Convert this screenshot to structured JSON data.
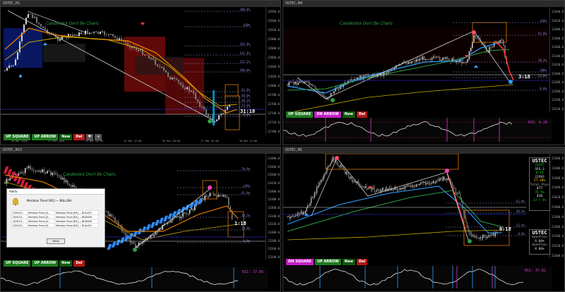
{
  "panes": [
    {
      "id": "h1",
      "title": "USTEC H1",
      "subtitle": "Candlestick Don't Be Charts",
      "title_color": "#2aa6f4",
      "countdown": "31:18",
      "ticks": [
        "22958.0",
        "22940.0",
        "22920.0",
        "22900.0",
        "22880.0",
        "22860.0",
        "22840.0",
        "22820.0",
        "22800.0",
        "22780.0",
        "22760.0",
        "22740.0",
        "22720.0",
        "22700.0"
      ],
      "levels": [
        "200.0%",
        "p50%",
        "161.8%",
        "141.4%",
        "127.2%",
        "100.0%",
        "61.8%",
        "50.0%",
        "38.2%",
        "23.6%",
        "0.0%"
      ],
      "toolbar": [
        "UP SQUARE",
        "UP ARROW",
        "New",
        "Del"
      ],
      "date_labels": [
        "20 Mar 2026",
        "21 Mar 2026",
        "24 Mar 04:00",
        "25 Mar 12:00",
        "26 Mar 20:00",
        "27 Mar 04:00",
        "28 Mar 12:00"
      ],
      "icons": [
        "heart-icon",
        "crosshair-icon"
      ]
    },
    {
      "id": "m4",
      "title": "USTEC M4",
      "subtitle": "Candlestick Don't Be Charts",
      "title_color": "#ff2a8a",
      "countdown": "3:18",
      "ticks": [
        "23440.0",
        "23420.0",
        "23400.0",
        "23380.0",
        "23360.0",
        "23340.0",
        "23320.0",
        "23300.0",
        "23280.0",
        "23260.0",
        "23240.0",
        "23220.0"
      ],
      "levels": [
        "p50%",
        "61.8%",
        "38.2%",
        "100%",
        "23.6%",
        "0.0%"
      ],
      "toolbar": [
        "UP SQUARE",
        "DN ARROW",
        "New",
        "Del"
      ],
      "osc_label": "RSI: 6.28",
      "date_labels": [
        "27 Mar 2026",
        "27 Mar 06:04",
        "27 Mar 07:48",
        "27 Mar 09:32",
        "27 Mar 11:16",
        "27 Mar 13:00",
        "27 Mar 14:44",
        "27 Mar 16:28",
        "27 Mar 18:12"
      ]
    },
    {
      "id": "m15",
      "title": "USTEC M15",
      "subtitle": "Candlestick Don't Be Charts",
      "title_color": "#2aa6f4",
      "countdown": "1:18",
      "ticks": [
        "23480.0",
        "23460.0",
        "23440.0",
        "23420.0",
        "23400.0",
        "23380.0",
        "23360.0",
        "23340.0",
        "23320.0",
        "23300.0",
        "23280.0",
        "23260.0",
        "23240.0"
      ],
      "levels": [
        "78.6%",
        "p50%",
        "61.8%",
        "38.2%",
        "23.6%",
        "0.0%"
      ],
      "toolbar": [
        "UP SQUARE",
        "UP ARROW",
        "New",
        "Del"
      ],
      "osc_label": "RSI: 37.66",
      "alert": {
        "title": "Alerts",
        "message": "Meridian Trend [M1] — BULLISH",
        "rows": [
          [
            "2026.03...",
            "Meridian Trend [U...",
            "Meridian Trend [M1] — BULLISH"
          ],
          [
            "2026.03...",
            "Meridian Trend [U...",
            "Meridian Trend [M1] — BEARISH"
          ],
          [
            "2026.03...",
            "Meridian Trend [U...",
            "Meridian Trend [M1] — BEARISH"
          ],
          [
            "2026.03...",
            "Meridian Trend [U...",
            "Meridian Trend [M1] — BULLISH"
          ]
        ],
        "close_label": "Faltal"
      }
    },
    {
      "id": "m1",
      "title": "USTEC M1",
      "countdown": "0:18",
      "ticks": [
        "23500.0",
        "23480.0",
        "23460.0",
        "23440.0",
        "23420.0",
        "23400.0",
        "23380.0",
        "23360.0",
        "23340.0",
        "23320.0",
        "23300.0"
      ],
      "levels": [
        "61.8%",
        "38.2%",
        "23.6%",
        "0.0%"
      ],
      "toolbar": [
        "DN SQUARE",
        "UP ARROW",
        "New",
        "Del"
      ],
      "osc_label": "RSI: 37.81",
      "stats_top": {
        "symbol": "USTEC",
        "l1": "23447",
        "l2": "SPS:3",
        "l3": "8:19",
        "l4": "22983",
        "l5": "57.18%",
        "l6": "Total Pips",
        "l7": "477",
        "l8": "76 5%",
        "l9": "416",
        "l10": "23 / 4%"
      },
      "stats_bottom": {
        "symbol": "USTEC",
        "l1": "OpenPips",
        "l2": "0.00%",
        "l3": "OpenPips",
        "l4": "0.00%"
      }
    }
  ]
}
